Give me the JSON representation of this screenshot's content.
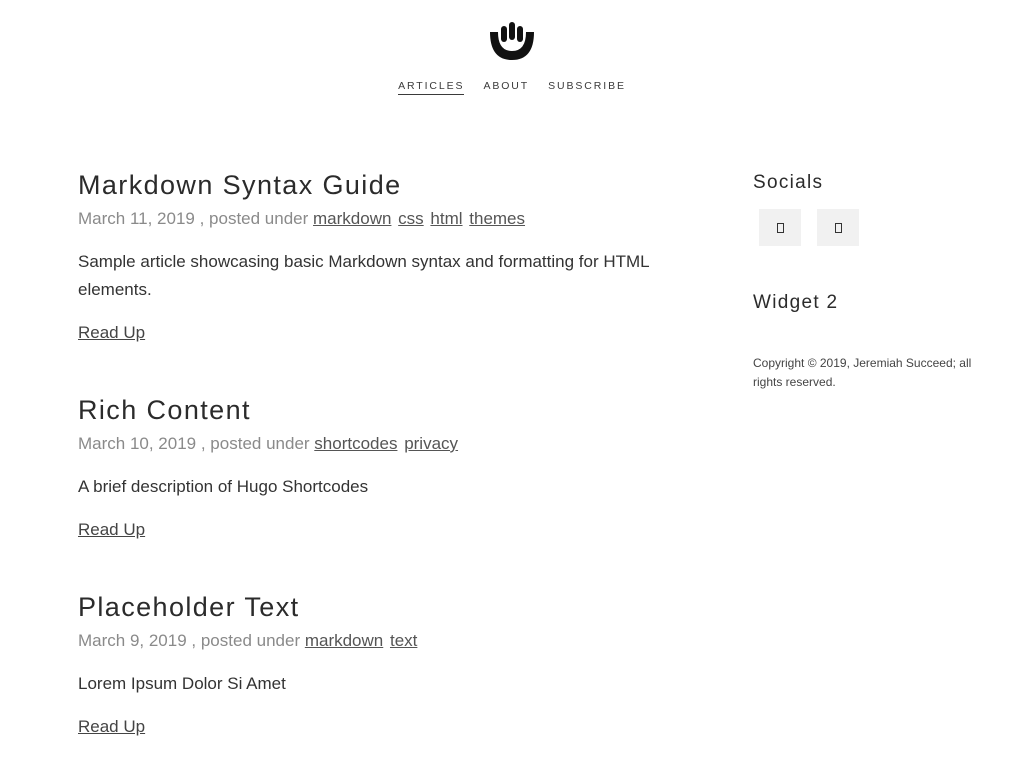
{
  "nav": {
    "items": [
      {
        "label": "ARTICLES",
        "active": true
      },
      {
        "label": "ABOUT",
        "active": false
      },
      {
        "label": "SUBSCRIBE",
        "active": false
      }
    ]
  },
  "articles": [
    {
      "title": "Markdown Syntax Guide",
      "date": "March 11, 2019",
      "posted_under": " , posted under ",
      "tags": [
        "markdown",
        "css",
        "html",
        "themes"
      ],
      "summary": "Sample article showcasing basic Markdown syntax and formatting for HTML elements.",
      "read_label": "Read Up"
    },
    {
      "title": "Rich Content",
      "date": "March 10, 2019",
      "posted_under": " , posted under ",
      "tags": [
        "shortcodes",
        "privacy"
      ],
      "summary": "A brief description of Hugo Shortcodes",
      "read_label": "Read Up"
    },
    {
      "title": "Placeholder Text",
      "date": "March 9, 2019",
      "posted_under": " , posted under ",
      "tags": [
        "markdown",
        "text"
      ],
      "summary": "Lorem Ipsum Dolor Si Amet",
      "read_label": "Read Up"
    }
  ],
  "sidebar": {
    "socials_title": "Socials",
    "social_icons": [
      "social-icon",
      "social-icon"
    ],
    "widget2_title": "Widget 2",
    "copyright": "Copyright © 2019, Jeremiah Succeed; all rights reserved."
  },
  "colors": {
    "text": "#2b2b2b",
    "meta": "#8a8a8a",
    "social_bg": "#f1f1f1"
  }
}
